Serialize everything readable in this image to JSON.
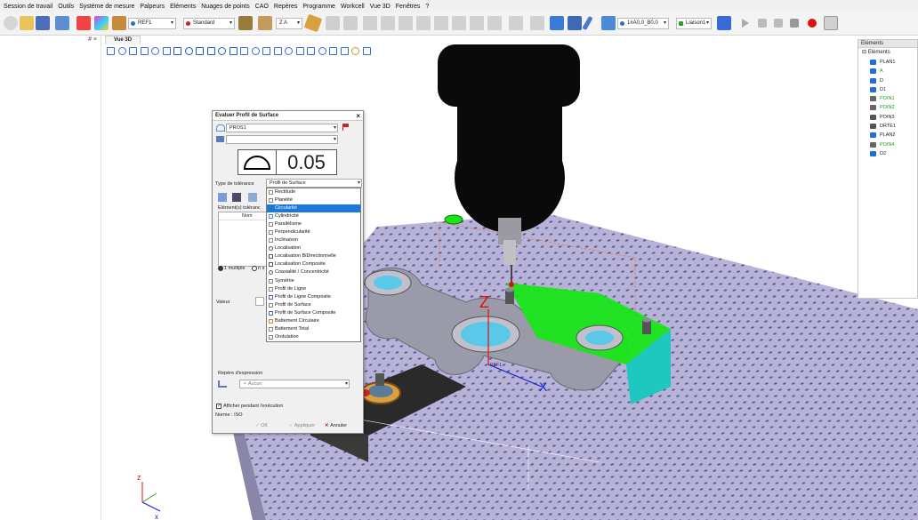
{
  "menu": [
    "Session de travail",
    "Outils",
    "Système de mesure",
    "Palpeurs",
    "Eléments",
    "Nuages de points",
    "CAO",
    "Repères",
    "Programme",
    "Workcell",
    "Vue 3D",
    "Fenêtres",
    "?"
  ],
  "toolbar": {
    "ref_combo": "REF1",
    "mode_combo": "Standard",
    "axis_combo": "Z A",
    "probe_combo": "1#A0,0_B0,0",
    "link_combo": "Liaison1"
  },
  "left_panel": {
    "controls": "# ×"
  },
  "view_tab": "Vue 3D",
  "elements_panel": {
    "title": "Eléments",
    "root": "Eléments",
    "items": [
      {
        "label": "PLAN1",
        "color": "#1f6fd6",
        "text_color": "#222"
      },
      {
        "label": "A",
        "color": "#1f6fd6",
        "text_color": "#1c9a1c"
      },
      {
        "label": "D",
        "color": "#1f6fd6",
        "text_color": "#222"
      },
      {
        "label": "D1",
        "color": "#1f6fd6",
        "text_color": "#222"
      },
      {
        "label": "POIN1",
        "color": "#666666",
        "text_color": "#1c9a1c"
      },
      {
        "label": "POIN2",
        "color": "#666666",
        "text_color": "#1c9a1c"
      },
      {
        "label": "POIN3",
        "color": "#555555",
        "text_color": "#222"
      },
      {
        "label": "DRTE1",
        "color": "#555555",
        "text_color": "#222"
      },
      {
        "label": "PLAN2",
        "color": "#1f6fd6",
        "text_color": "#222"
      },
      {
        "label": "POIN4",
        "color": "#666666",
        "text_color": "#1c9a1c"
      },
      {
        "label": "D2",
        "color": "#1f6fd6",
        "text_color": "#222"
      }
    ]
  },
  "dialog": {
    "title": "Evaluer Profil de Surface",
    "element_combo": "PROS1",
    "tolerance_value": "0.05",
    "tolerance_type_label": "Type de tolérance",
    "tolerance_type_value": "Profil de Surface",
    "elements_label": "Elément(s) toléranc",
    "list_header": "Nom",
    "radio_multiple": "1 multiple",
    "radio_n": "n s",
    "value_label": "Valeur",
    "expression_label": "Repère d'expression",
    "expression_value": "Aucun",
    "display_checkbox": "Afficher pendant l'exécution",
    "norm_label": "Norme : ISO",
    "ok": "OK",
    "apply": "Appliquer",
    "cancel": "Annuler"
  },
  "dropdown": {
    "items": [
      "Rectitude",
      "Planéité",
      "Circularité",
      "Cylindricité",
      "Parallélisme",
      "Perpendicularité",
      "Inclinaison",
      "Localisation",
      "Localisation BiDirectionnelle",
      "Localisation Composite",
      "Coaxialité / Concentricité",
      "Symétrie",
      "Profil de Ligne",
      "Profil de Ligne Composite",
      "Profil de Surface",
      "Profil de Surface Composite",
      "Battement Circulaire",
      "Battement Total",
      "Ondulation"
    ],
    "selected_index": 2
  },
  "scene": {
    "axis_z": "Z",
    "axis_x": "X",
    "ref_label": "REF1",
    "mini_z": "z",
    "mini_x": "x",
    "colors": {
      "plate": "#b7b2d8",
      "hole": "#5a5680",
      "part": "#9a9aa8",
      "green": "#19e619",
      "cyan": "#1ec8c0",
      "probe_head": "#0a0a0a",
      "axis_red": "#e01010",
      "axis_blue": "#1020d0",
      "highlight": "#1e78d7"
    }
  }
}
